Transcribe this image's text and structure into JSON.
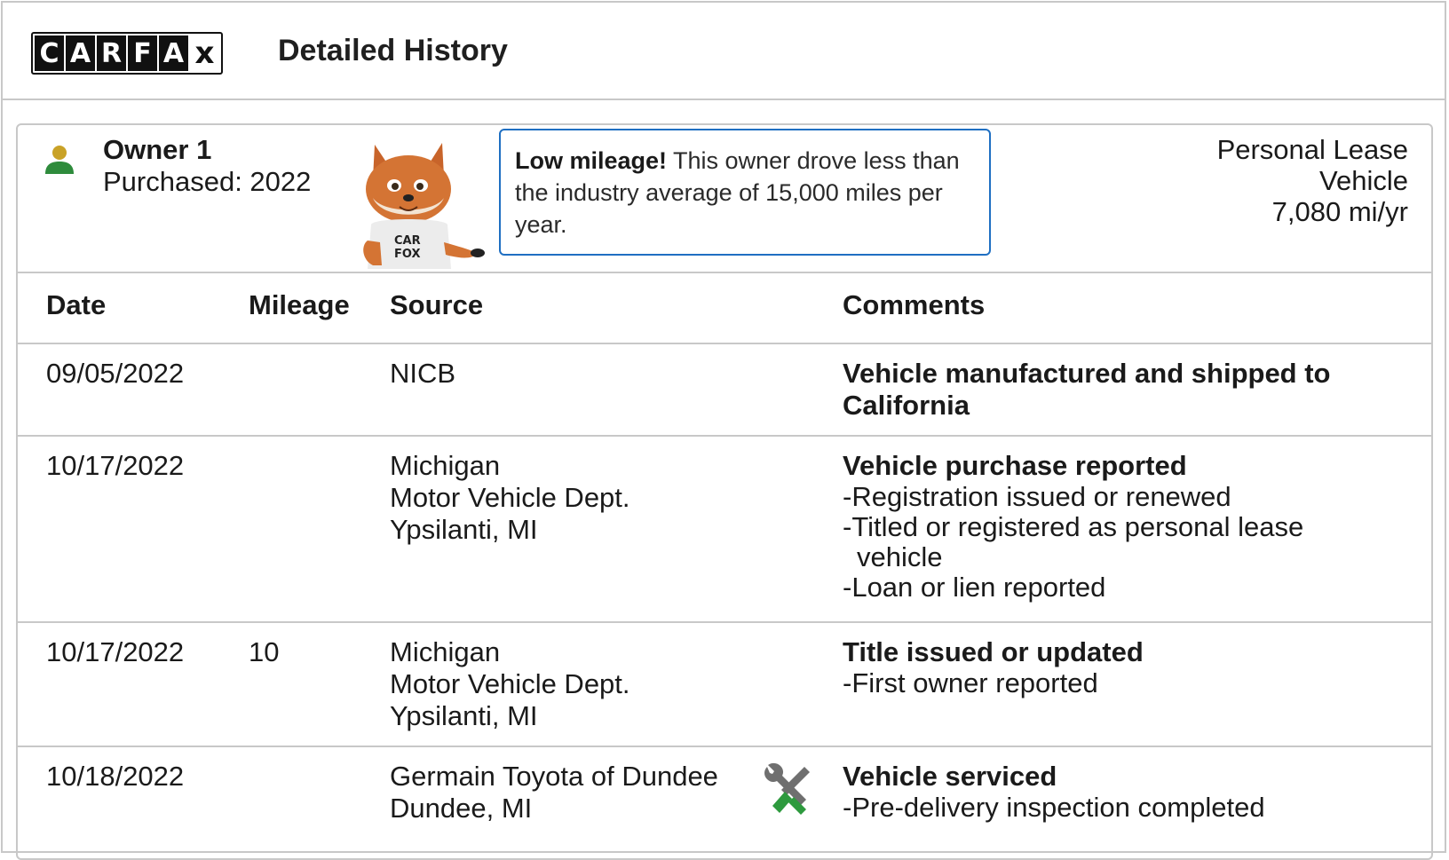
{
  "header": {
    "logo_letters": [
      "C",
      "A",
      "R",
      "F",
      "A",
      "x"
    ],
    "title": "Detailed History"
  },
  "owner": {
    "name": "Owner 1",
    "purchased": "Purchased: 2022",
    "callout_bold": "Low mileage!",
    "callout_text": " This owner drove less than the industry average of 15,000 miles per year.",
    "lease_line1": "Personal Lease",
    "lease_line2": "Vehicle",
    "mileage_per_year": "7,080 mi/yr"
  },
  "table": {
    "headers": {
      "date": "Date",
      "mileage": "Mileage",
      "source": "Source",
      "comments": "Comments"
    },
    "rows": [
      {
        "date": "09/05/2022",
        "mileage": "",
        "source": [
          "NICB"
        ],
        "comment_head": "Vehicle manufactured and shipped to California",
        "comment_items": []
      },
      {
        "date": "10/17/2022",
        "mileage": "",
        "source": [
          "Michigan",
          "Motor Vehicle Dept.",
          "Ypsilanti, MI"
        ],
        "comment_head": "Vehicle purchase reported",
        "comment_items": [
          "Registration issued or renewed",
          "Titled or registered as personal lease vehicle",
          "Loan or lien reported"
        ]
      },
      {
        "date": "10/17/2022",
        "mileage": "10",
        "source": [
          "Michigan",
          "Motor Vehicle Dept.",
          "Ypsilanti, MI"
        ],
        "comment_head": "Title issued or updated",
        "comment_items": [
          "First owner reported"
        ]
      },
      {
        "date": "10/18/2022",
        "mileage": "",
        "source": [
          "Germain Toyota of Dundee",
          "Dundee, MI"
        ],
        "comment_head": "Vehicle serviced",
        "comment_items": [
          "Pre-delivery inspection completed"
        ]
      }
    ]
  },
  "icons": {
    "owner": "person-icon",
    "mascot": "carfox-mascot",
    "service": "wrench-screwdriver-icon"
  },
  "colors": {
    "callout_border": "#1f6fc2",
    "person_head": "#c9a227",
    "person_body": "#2e8b3c",
    "service_green": "#2e9a3e",
    "service_gray": "#6f6f6f"
  }
}
